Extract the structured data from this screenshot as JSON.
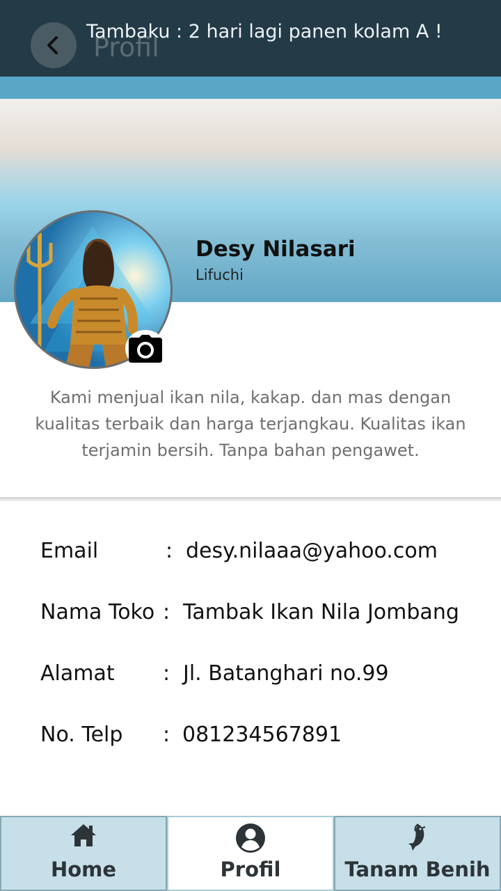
{
  "header": {
    "title": "Profil",
    "notification": "Tambaku : 2 hari lagi panen kolam A !",
    "back_icon": "chevron-left-icon"
  },
  "profile": {
    "name": "Desy Nilasari",
    "username": "Lifuchi",
    "avatar_icon": "avatar-photo",
    "camera_icon": "camera-icon",
    "bio": "Kami menjual ikan nila, kakap. dan mas dengan kualitas terbaik dan harga terjangkau. Kualitas ikan terjamin bersih. Tanpa bahan pengawet."
  },
  "info": [
    {
      "label": "Email",
      "colon": ":",
      "value": "desy.nilaaa@yahoo.com"
    },
    {
      "label": "Nama Toko",
      "colon": ":",
      "value": "Tambak Ikan Nila Jombang"
    },
    {
      "label": "Alamat",
      "colon": ":",
      "value": "Jl. Batanghari no.99"
    },
    {
      "label": "No. Telp",
      "colon": ":",
      "value": "081234567891"
    }
  ],
  "nav": [
    {
      "label": "Home",
      "icon": "home-icon",
      "active": false
    },
    {
      "label": "Profil",
      "icon": "user-circle-icon",
      "active": true
    },
    {
      "label": "Tanam Benih",
      "icon": "fish-icon",
      "active": false
    }
  ],
  "colors": {
    "header_bg": "#233a47",
    "accent": "#5aa6c6",
    "nav_inactive": "#c6dfe8"
  }
}
